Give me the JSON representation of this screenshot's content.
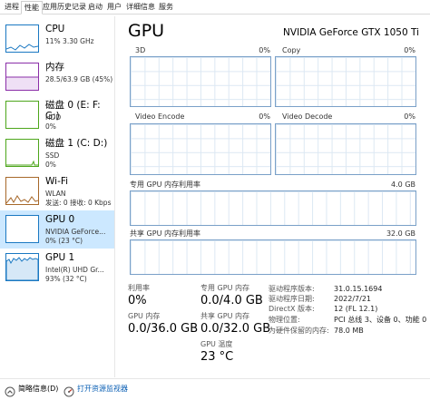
{
  "tabs": [
    "进程",
    "性能",
    "应用历史记录",
    "启动",
    "用户",
    "详细信息",
    "服务"
  ],
  "active_tab": "性能",
  "sidebar": {
    "items": [
      {
        "title": "CPU",
        "line1": "11%  3.30 GHz",
        "line2": ""
      },
      {
        "title": "内存",
        "line1": "28.5/63.9 GB (45%)",
        "line2": ""
      },
      {
        "title": "磁盘 0 (E: F: G:)",
        "line1": "HDD",
        "line2": "0%"
      },
      {
        "title": "磁盘 1 (C: D:)",
        "line1": "SSD",
        "line2": "0%"
      },
      {
        "title": "Wi-Fi",
        "line1": "WLAN",
        "line2": "发送: 0 接收: 0 Kbps"
      },
      {
        "title": "GPU 0",
        "line1": "NVIDIA GeForce...",
        "line2": "0% (23 °C)"
      },
      {
        "title": "GPU 1",
        "line1": "Intel(R) UHD Gr...",
        "line2": "93% (32 °C)"
      }
    ],
    "selected_index": 5
  },
  "main": {
    "title": "GPU",
    "device_name": "NVIDIA GeForce GTX 1050 Ti",
    "engines": [
      {
        "name": "3D",
        "percent": "0%"
      },
      {
        "name": "Copy",
        "percent": "0%"
      },
      {
        "name": "Video Encode",
        "percent": "0%"
      },
      {
        "name": "Video Decode",
        "percent": "0%"
      }
    ],
    "dedicated_label": "专用 GPU 内存利用率",
    "dedicated_max": "4.0 GB",
    "shared_label": "共享 GPU 内存利用率",
    "shared_max": "32.0 GB"
  },
  "stats": {
    "util_label": "利用率",
    "util_value": "0%",
    "ded_label": "专用 GPU 内存",
    "ded_value": "0.0/4.0 GB",
    "gpu_mem_label": "GPU 内存",
    "gpu_mem_value": "0.0/36.0 GB",
    "shared_label": "共享 GPU 内存",
    "shared_value": "0.0/32.0 GB",
    "temp_label": "GPU 温度",
    "temp_value": "23 °C"
  },
  "info": [
    {
      "key": "驱动程序版本:",
      "value": "31.0.15.1694"
    },
    {
      "key": "驱动程序日期:",
      "value": "2022/7/21"
    },
    {
      "key": "DirectX 版本:",
      "value": "12 (FL 12.1)"
    },
    {
      "key": "物理位置:",
      "value": "PCI 总线 3、设备 0、功能 0"
    },
    {
      "key": "为硬件保留的内存:",
      "value": "78.0 MB"
    }
  ],
  "footer": {
    "summary_label": "简略信息(D)",
    "resmon_label": "打开资源监视器"
  },
  "colors": {
    "selected_bg": "#cce8ff",
    "graph_border": "#7aa0c8",
    "cpu_color": "#1a78c2",
    "mem_color": "#8b2fa8",
    "disk_color": "#4da61b",
    "wifi_color": "#a7682a",
    "gpu_color": "#1a78c2",
    "link_color": "#0a5fb4"
  },
  "icons": {
    "summary": "chevron-up-icon",
    "resmon": "resource-monitor-icon"
  }
}
